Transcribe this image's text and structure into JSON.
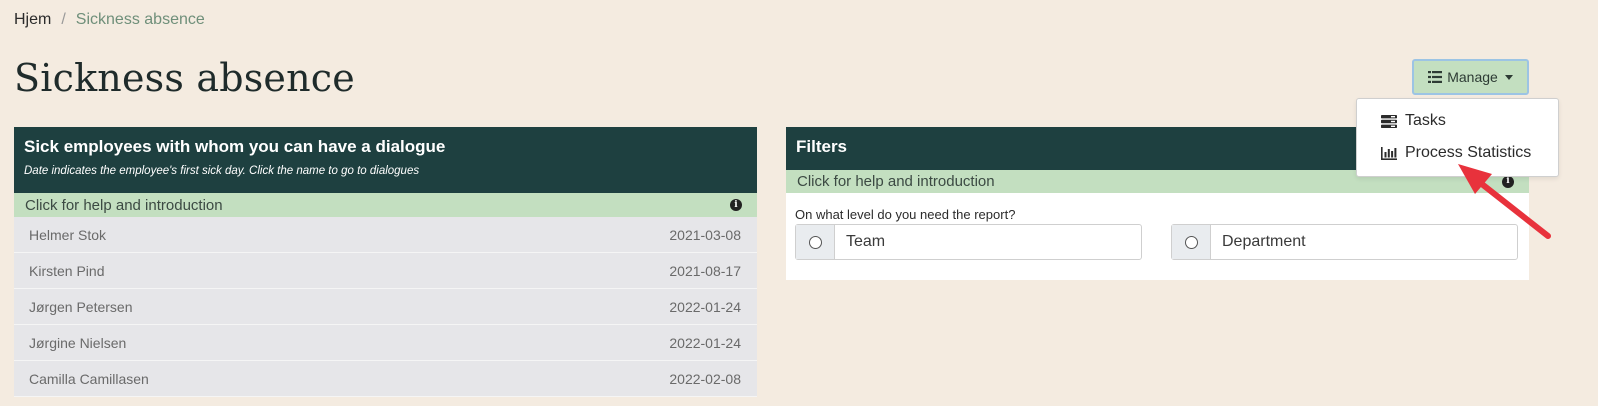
{
  "breadcrumb": {
    "home": "Hjem",
    "separator": "/",
    "current": "Sickness absence"
  },
  "page": {
    "title": "Sickness absence"
  },
  "manage": {
    "label": "Manage",
    "icon": "list-icon",
    "menu": [
      {
        "label": "Tasks",
        "icon": "tasks-icon"
      },
      {
        "label": "Process Statistics",
        "icon": "bar-chart-icon"
      }
    ]
  },
  "left_panel": {
    "title": "Sick employees with whom you can have a dialogue",
    "subtitle": "Date indicates the employee's first sick day. Click the name to go to dialogues",
    "help": "Click for help and introduction",
    "employees": [
      {
        "name": "Helmer Stok",
        "date": "2021-03-08"
      },
      {
        "name": "Kirsten Pind",
        "date": "2021-08-17"
      },
      {
        "name": "Jørgen Petersen",
        "date": "2022-01-24"
      },
      {
        "name": "Jørgine Nielsen",
        "date": "2022-01-24"
      },
      {
        "name": "Camilla Camillasen",
        "date": "2022-02-08"
      }
    ]
  },
  "right_panel": {
    "title": "Filters",
    "help": "Click for help and introduction",
    "question": "On what level do you need the report?",
    "options": [
      "Team",
      "Department"
    ]
  },
  "colors": {
    "background": "#f4ebe0",
    "panel_header": "#1e4040",
    "help_bar": "#c3dfc0",
    "annotation_arrow": "#e8323c"
  }
}
